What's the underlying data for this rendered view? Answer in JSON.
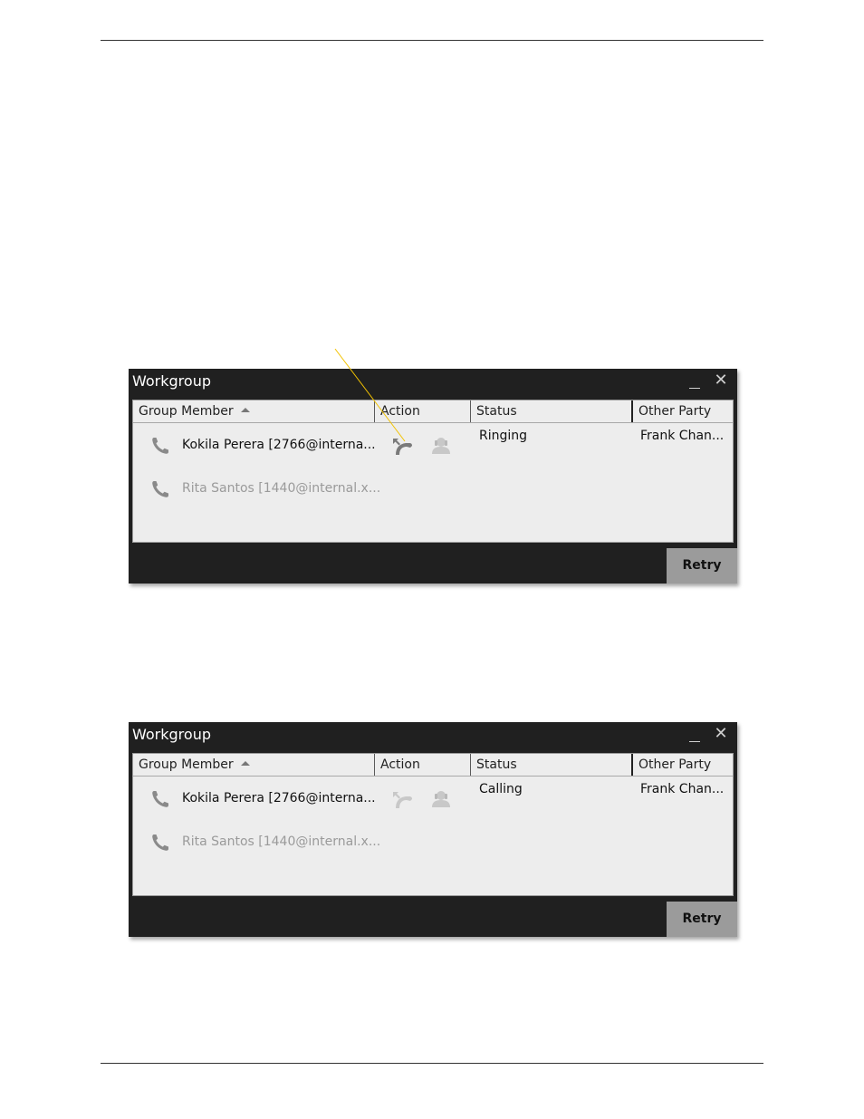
{
  "windows": [
    {
      "title": "Workgroup",
      "columns": {
        "member": "Group Member",
        "action": "Action",
        "status": "Status",
        "other_party": "Other Party"
      },
      "rows": [
        {
          "member": "Kokila Perera [2766@interna...",
          "status": "Ringing",
          "other_party": "Frank Chan...",
          "actions_enabled": true
        },
        {
          "member": "Rita Santos [1440@internal.x...",
          "status": "",
          "other_party": "",
          "actions_enabled": false
        }
      ],
      "retry_label": "Retry"
    },
    {
      "title": "Workgroup",
      "columns": {
        "member": "Group Member",
        "action": "Action",
        "status": "Status",
        "other_party": "Other Party"
      },
      "rows": [
        {
          "member": "Kokila Perera [2766@interna...",
          "status": "Calling",
          "other_party": "Frank Chan...",
          "actions_enabled": false
        },
        {
          "member": "Rita Santos [1440@internal.x...",
          "status": "",
          "other_party": "",
          "actions_enabled": false
        }
      ],
      "retry_label": "Retry"
    }
  ],
  "icons": {
    "minimize": "minimize-icon",
    "close": "close-icon",
    "phone": "phone-icon",
    "pickup": "call-pickup-icon",
    "coach": "coach-icon",
    "sort": "sort-ascending-icon"
  },
  "colors": {
    "window_bg": "#202020",
    "panel_bg": "#ededed",
    "retry_bg": "#9b9b9b",
    "callout_line": "#f2c200",
    "icon_gray": "#8a8a8a",
    "icon_light": "#c8c8c8"
  }
}
